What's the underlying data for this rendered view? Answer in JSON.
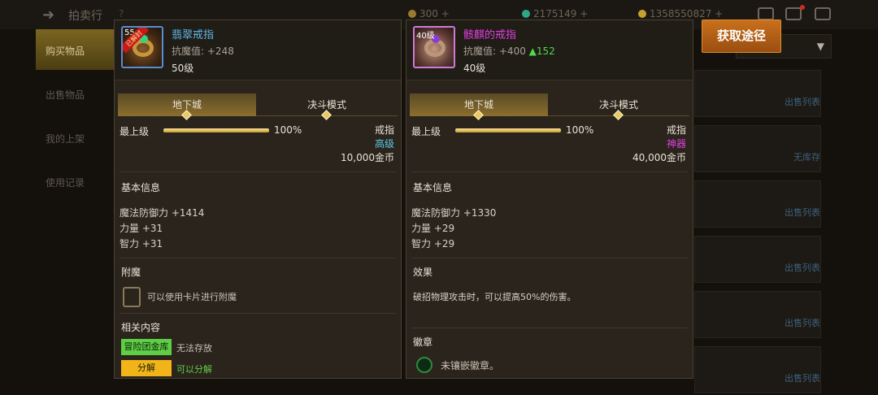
{
  "app": {
    "title": "拍卖行"
  },
  "resources": [
    {
      "value": "300",
      "color": "#9a7a30"
    },
    {
      "value": "2175149",
      "color": "#2aa88a"
    },
    {
      "value": "1358550827",
      "color": "#c8a030"
    }
  ],
  "sidebar": {
    "items": [
      {
        "label": "购买物品",
        "active": true
      },
      {
        "label": "出售物品",
        "active": false
      },
      {
        "label": "我的上架",
        "active": false
      },
      {
        "label": "使用记录",
        "active": false
      }
    ]
  },
  "listing": {
    "rows": [
      {
        "text": "出售列表"
      },
      {
        "text": "无库存"
      },
      {
        "text": "出售列表"
      },
      {
        "text": "出售列表"
      },
      {
        "text": "出售列表"
      },
      {
        "text": "出售列表"
      }
    ]
  },
  "get_source_button": "获取途径",
  "left_item": {
    "name": "翡翠戒指",
    "name_color": "#5fb8e8",
    "icon": "ring-icon",
    "icon_level": "55",
    "icon_ribbon": "已解封",
    "resist_label": "抗魔值:",
    "resist_value": "+248",
    "req_level": "50级",
    "tabs": [
      {
        "label": "地下城",
        "active": true
      },
      {
        "label": "决斗模式",
        "active": false
      }
    ],
    "grade_label": "最上级",
    "grade_percent": 100,
    "grade_percent_text": "100%",
    "type": "戒指",
    "rarity": "高级",
    "rarity_color": "#5fc8e8",
    "price": "10,000金币",
    "basic_title": "基本信息",
    "stats": [
      "魔法防御力 +1414",
      "力量 +31",
      "智力 +31"
    ],
    "enchant_title": "附魔",
    "enchant_text": "可以使用卡片进行附魔",
    "related_title": "相关内容",
    "related": [
      {
        "badge": "冒险团金库",
        "note": "无法存放",
        "badge_color": "#5ecf44",
        "note_color": "#c9c2b4"
      },
      {
        "badge": "分解",
        "note": "可以分解",
        "badge_color": "#f2b418",
        "note_color": "#5ecf44"
      }
    ]
  },
  "right_item": {
    "name": "骸麒的戒指",
    "name_color": "#e040e0",
    "icon": "ring-icon",
    "icon_level": "40级",
    "resist_label": "抗魔值:",
    "resist_value": "+400",
    "resist_diff": "▲152",
    "req_level": "40级",
    "tabs": [
      {
        "label": "地下城",
        "active": true
      },
      {
        "label": "决斗模式",
        "active": false
      }
    ],
    "grade_label": "最上级",
    "grade_percent": 100,
    "grade_percent_text": "100%",
    "type": "戒指",
    "rarity": "神器",
    "rarity_color": "#e040e0",
    "price": "40,000金币",
    "basic_title": "基本信息",
    "stats": [
      "魔法防御力 +1330",
      "力量 +29",
      "智力 +29"
    ],
    "effect_title": "效果",
    "effect_text": "破招物理攻击时，可以提高50%的伤害。",
    "emblem_title": "徽章",
    "emblem_text": "未镶嵌徽章。"
  }
}
